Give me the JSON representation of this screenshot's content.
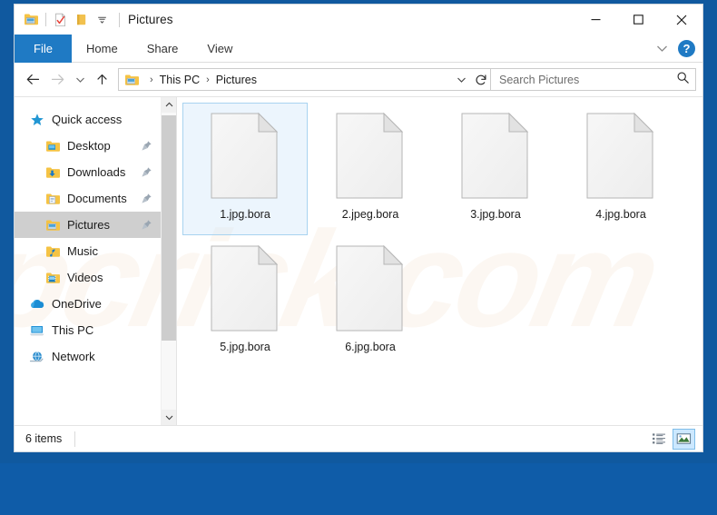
{
  "window": {
    "title": "Pictures",
    "quick_access_toolbar": [
      {
        "name": "pictures-folder-properties-icon",
        "icon": "folder-picture"
      },
      {
        "name": "checkmark-document-icon",
        "icon": "doc-check"
      },
      {
        "name": "new-folder-icon",
        "icon": "folder"
      },
      {
        "name": "customize-toolbar-dropdown",
        "icon": "chevron-down"
      }
    ],
    "controls": {
      "minimize": "─",
      "maximize": "☐",
      "close": "✕"
    }
  },
  "ribbon": {
    "tabs": [
      {
        "label": "File",
        "active": true
      },
      {
        "label": "Home",
        "active": false
      },
      {
        "label": "Share",
        "active": false
      },
      {
        "label": "View",
        "active": false
      }
    ],
    "collapse_label": "⌄",
    "help_label": "?"
  },
  "address": {
    "back_label": "←",
    "forward_label": "→",
    "recent_label": "⌄",
    "up_label": "↑",
    "breadcrumbs": [
      "This PC",
      "Pictures"
    ],
    "separator": "›",
    "dropdown_label": "⌄",
    "refresh_label": "↻"
  },
  "search": {
    "placeholder": "Search Pictures",
    "value": ""
  },
  "sidebar": {
    "items": [
      {
        "label": "Quick access",
        "icon": "star-icon",
        "indent": false,
        "pinned": false,
        "selected": false
      },
      {
        "label": "Desktop",
        "icon": "folder-desktop-icon",
        "indent": true,
        "pinned": true,
        "selected": false
      },
      {
        "label": "Downloads",
        "icon": "folder-downloads-icon",
        "indent": true,
        "pinned": true,
        "selected": false
      },
      {
        "label": "Documents",
        "icon": "folder-documents-icon",
        "indent": true,
        "pinned": true,
        "selected": false
      },
      {
        "label": "Pictures",
        "icon": "folder-pictures-icon",
        "indent": true,
        "pinned": true,
        "selected": true
      },
      {
        "label": "Music",
        "icon": "folder-music-icon",
        "indent": true,
        "pinned": false,
        "selected": false
      },
      {
        "label": "Videos",
        "icon": "folder-videos-icon",
        "indent": true,
        "pinned": false,
        "selected": false
      },
      {
        "label": "OneDrive",
        "icon": "onedrive-cloud-icon",
        "indent": false,
        "pinned": false,
        "selected": false
      },
      {
        "label": "This PC",
        "icon": "this-pc-icon",
        "indent": false,
        "pinned": false,
        "selected": false
      },
      {
        "label": "Network",
        "icon": "network-icon",
        "indent": false,
        "pinned": false,
        "selected": false
      }
    ],
    "scroll_up_label": "⌃",
    "scroll_down_label": "⌄"
  },
  "files": [
    {
      "name": "1.jpg.bora",
      "selected": true
    },
    {
      "name": "2.jpeg.bora",
      "selected": false
    },
    {
      "name": "3.jpg.bora",
      "selected": false
    },
    {
      "name": "4.jpg.bora",
      "selected": false
    },
    {
      "name": "5.jpg.bora",
      "selected": false
    },
    {
      "name": "6.jpg.bora",
      "selected": false
    }
  ],
  "status": {
    "item_count": "6 items",
    "views": [
      {
        "name": "details-view-button",
        "active": false
      },
      {
        "name": "large-icons-view-button",
        "active": true
      }
    ]
  },
  "watermark": {
    "text": "pcrisk.com"
  },
  "colors": {
    "accent": "#1f7ac4",
    "desktop": "#10599f",
    "selection": "#cce8ff",
    "selection_border": "#a8d3f0",
    "nav_selected": "#cfcfcf"
  }
}
